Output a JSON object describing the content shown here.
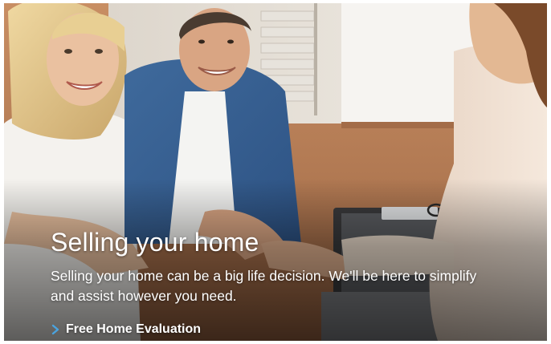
{
  "banner": {
    "title": "Selling your home",
    "description": "Selling your home can be a big life decision. We'll be here to simplify and assist however you need.",
    "cta_label": "Free Home Evaluation",
    "cta_icon": "chevron-right-icon",
    "accent_color": "#4aa3df",
    "image_name": "couple-handshake-photo"
  }
}
